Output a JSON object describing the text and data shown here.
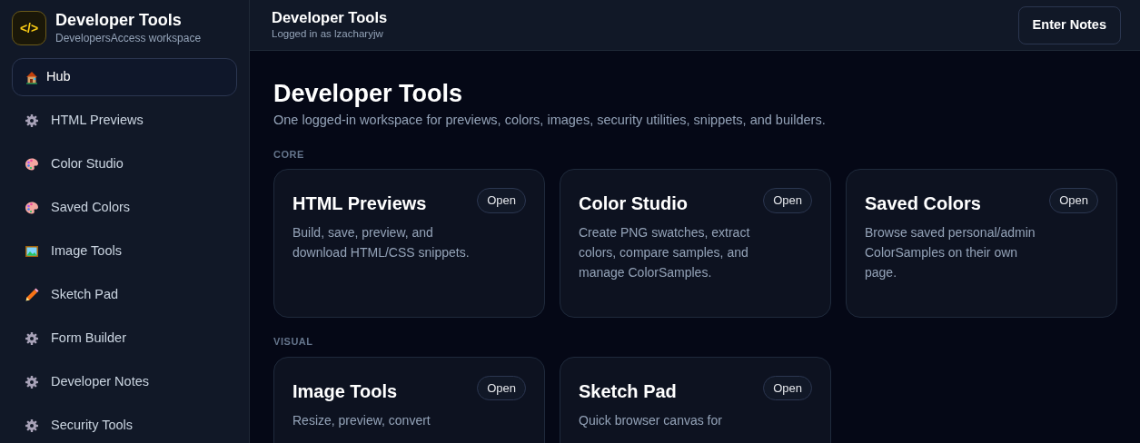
{
  "brand": {
    "logo": "</>",
    "title": "Developer Tools",
    "subtitle": "DevelopersAccess workspace"
  },
  "nav": [
    {
      "label": "Hub",
      "kind": "house",
      "selected": true
    },
    {
      "label": "HTML Previews",
      "kind": "gear",
      "selected": false
    },
    {
      "label": "Color Studio",
      "kind": "palette",
      "selected": false
    },
    {
      "label": "Saved Colors",
      "kind": "palette",
      "selected": false
    },
    {
      "label": "Image Tools",
      "kind": "picture",
      "selected": false
    },
    {
      "label": "Sketch Pad",
      "kind": "pencil",
      "selected": false
    },
    {
      "label": "Form Builder",
      "kind": "gear",
      "selected": false
    },
    {
      "label": "Developer Notes",
      "kind": "gear",
      "selected": false
    },
    {
      "label": "Security Tools",
      "kind": "gear",
      "selected": false
    }
  ],
  "header": {
    "title": "Developer Tools",
    "subtitle": "Logged in as lzacharyjw",
    "button": "Enter Notes"
  },
  "page": {
    "title": "Developer Tools",
    "description": "One logged-in workspace for previews, colors, images, security utilities, snippets, and builders."
  },
  "sections": [
    {
      "label": "CORE",
      "cards": [
        {
          "title": "HTML Previews",
          "description": "Build, save, preview, and download HTML/CSS snippets.",
          "button": "Open"
        },
        {
          "title": "Color Studio",
          "description": "Create PNG swatches, extract colors, compare samples, and manage ColorSamples.",
          "button": "Open"
        },
        {
          "title": "Saved Colors",
          "description": "Browse saved personal/admin ColorSamples on their own page.",
          "button": "Open"
        }
      ]
    },
    {
      "label": "VISUAL",
      "cards": [
        {
          "title": "Image Tools",
          "description": "Resize, preview, convert",
          "button": "Open"
        },
        {
          "title": "Sketch Pad",
          "description": "Quick browser canvas for",
          "button": "Open"
        }
      ]
    }
  ]
}
